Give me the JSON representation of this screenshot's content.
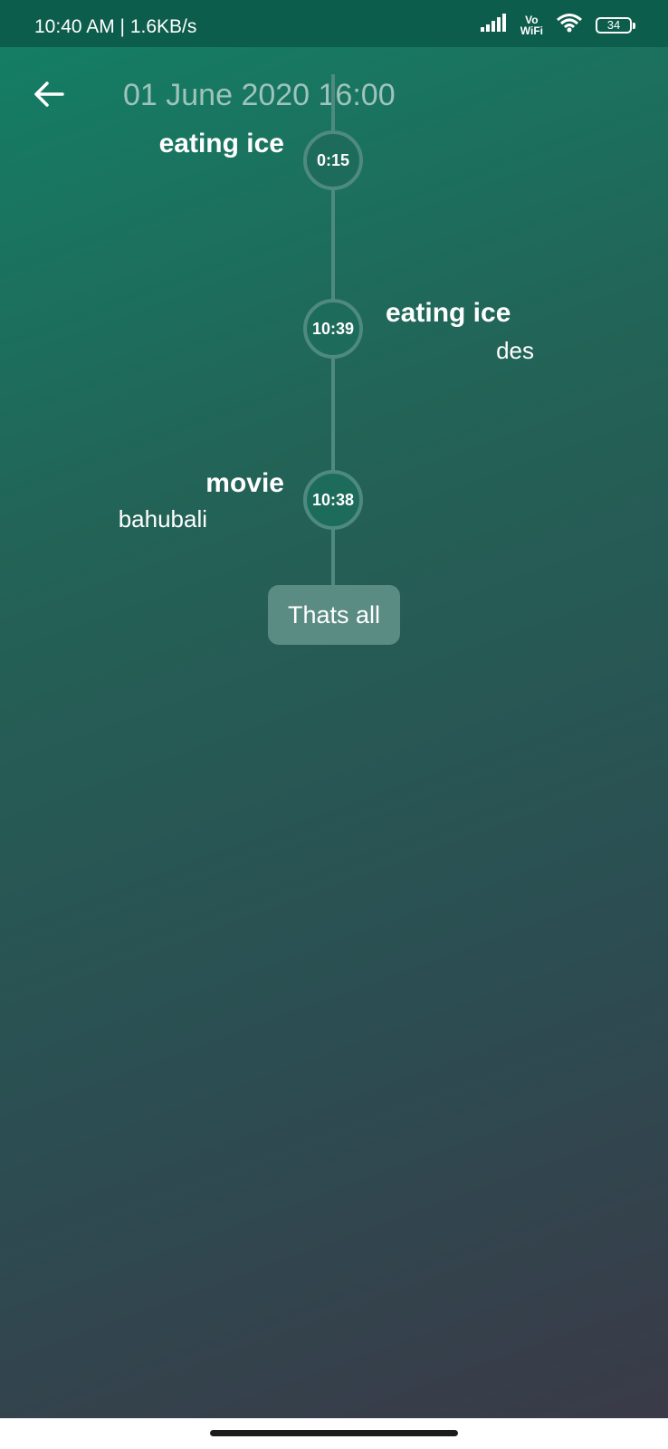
{
  "status_bar": {
    "time_speed": "10:40 AM | 1.6KB/s",
    "vowifi_top": "Vo",
    "vowifi_bottom": "WiFi",
    "battery": "34",
    "icons": [
      "signal-icon",
      "wifi-icon",
      "battery-icon"
    ]
  },
  "header": {
    "back_icon": "arrow-left-icon",
    "title": "01 June 2020 16:00"
  },
  "timeline": {
    "events": [
      {
        "time": "0:15",
        "title": "eating ice",
        "description": "",
        "side": "left"
      },
      {
        "time": "10:39",
        "title": "eating ice",
        "description": "des",
        "side": "right"
      },
      {
        "time": "10:38",
        "title": "movie",
        "description": "bahubali",
        "side": "left"
      }
    ],
    "end_label": "Thats all"
  },
  "colors": {
    "gradient_start": "#138066",
    "gradient_end": "#3a3a48",
    "status_bar": "#0d5d4c",
    "timeline_line": "#4f8a7f",
    "title_text": "#9ec4bb",
    "end_chip": "#5b8c84"
  }
}
